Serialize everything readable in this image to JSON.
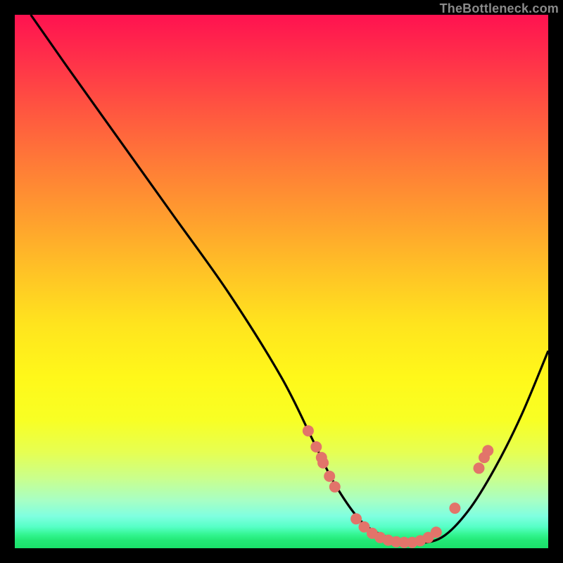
{
  "watermark": "TheBottleneck.com",
  "colors": {
    "background": "#000000",
    "dot": "#e2746a",
    "curve": "#000000"
  },
  "chart_data": {
    "type": "line",
    "title": "",
    "xlabel": "",
    "ylabel": "",
    "xlim": [
      0,
      100
    ],
    "ylim": [
      0,
      100
    ],
    "grid": false,
    "legend": false,
    "series": [
      {
        "name": "curve",
        "x": [
          3,
          10,
          20,
          30,
          40,
          50,
          56,
          60,
          65,
          70,
          75,
          80,
          85,
          90,
          95,
          100
        ],
        "y": [
          100,
          90,
          76,
          62,
          48,
          32,
          20,
          12,
          5,
          2,
          1,
          2,
          7,
          15,
          25,
          37
        ]
      }
    ],
    "scatter_points": [
      {
        "x": 55,
        "y": 22
      },
      {
        "x": 56.5,
        "y": 19
      },
      {
        "x": 57.5,
        "y": 17
      },
      {
        "x": 57.8,
        "y": 16
      },
      {
        "x": 59,
        "y": 13.5
      },
      {
        "x": 60,
        "y": 11.5
      },
      {
        "x": 64,
        "y": 5.5
      },
      {
        "x": 65.5,
        "y": 4
      },
      {
        "x": 67,
        "y": 2.8
      },
      {
        "x": 68.5,
        "y": 2
      },
      {
        "x": 70,
        "y": 1.5
      },
      {
        "x": 71.5,
        "y": 1.2
      },
      {
        "x": 73,
        "y": 1.1
      },
      {
        "x": 74.5,
        "y": 1.1
      },
      {
        "x": 76,
        "y": 1.4
      },
      {
        "x": 77.5,
        "y": 2
      },
      {
        "x": 79,
        "y": 3
      },
      {
        "x": 82.5,
        "y": 7.5
      },
      {
        "x": 87,
        "y": 15
      },
      {
        "x": 88,
        "y": 17
      },
      {
        "x": 88.7,
        "y": 18.3
      }
    ]
  }
}
